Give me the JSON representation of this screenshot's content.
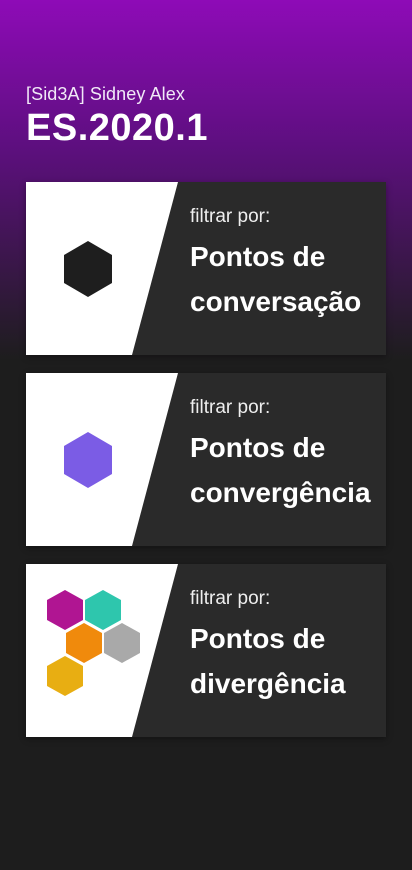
{
  "header": {
    "subtitle": "[Sid3A] Sidney Alex",
    "title": "ES.2020.1"
  },
  "colors": {
    "gradient_top": "#8e0bb7",
    "background": "#1d1d1d",
    "card": "#2a2a2a",
    "conversation_hex": "#1e1e1e",
    "convergence_hex": "#7b5ce5",
    "divergence_hexes": [
      "#b01592",
      "#2ec6ad",
      "#f08a0c",
      "#a9a9a9",
      "#e8ae12"
    ]
  },
  "cards": [
    {
      "filter_label": "filtrar por:",
      "line1": "Pontos de",
      "line2": "conversação",
      "icon": "hexagon-dark-icon"
    },
    {
      "filter_label": "filtrar por:",
      "line1": "Pontos de",
      "line2": "convergência",
      "icon": "hexagon-purple-icon"
    },
    {
      "filter_label": "filtrar por:",
      "line1": "Pontos de",
      "line2": "divergência",
      "icon": "hexagon-cluster-icon"
    }
  ]
}
